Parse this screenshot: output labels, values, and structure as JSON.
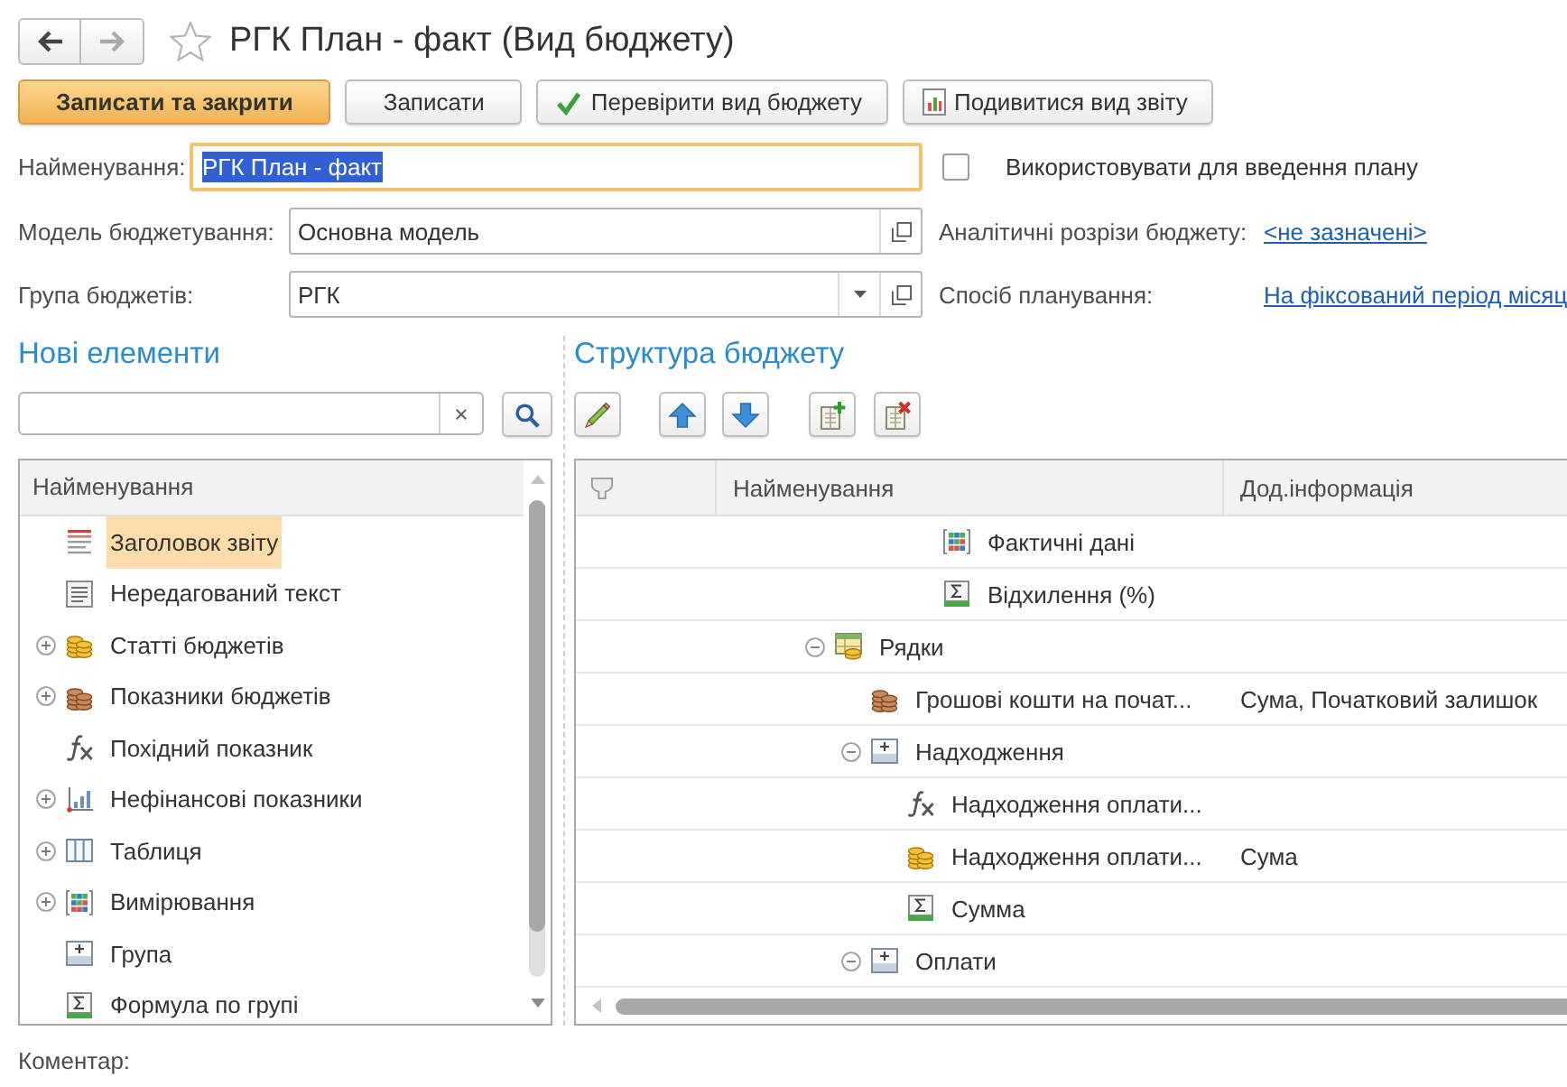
{
  "window": {
    "title": "РГК План - факт (Вид бюджету)",
    "favorite": false
  },
  "navigation": {
    "back": {
      "disabled": false
    },
    "forward": {
      "disabled": true
    }
  },
  "toolbar": [
    {
      "kind": "save_close",
      "label": "Записати та закрити"
    },
    {
      "kind": "save",
      "label": "Записати"
    },
    {
      "kind": "check",
      "label": "Перевірити вид бюджету"
    },
    {
      "kind": "view_report",
      "label": "Подивитися вид звіту"
    }
  ],
  "form": {
    "name": {
      "label": "Найменування:",
      "value": "РГК План - факт",
      "focused": true
    },
    "use_for_plan": {
      "label": "Використовувати для введення плану",
      "checked": false
    },
    "model": {
      "label": "Модель бюджетування:",
      "value": "Основна модель"
    },
    "analytics": {
      "label": "Аналітичні розрізи бюджету:",
      "link": "<не зазначені>"
    },
    "group": {
      "label": "Група бюджетів:",
      "value": "РГК"
    },
    "planning": {
      "label": "Спосіб планування:",
      "link": "На фіксований період місяц"
    }
  },
  "new_elements": {
    "title": "Нові елементи",
    "column": "Найменування",
    "items": [
      {
        "kind": "report_header",
        "label": "Заголовок звіту",
        "selected": true
      },
      {
        "kind": "text",
        "label": "Нередагований текст",
        "selected": false
      },
      {
        "kind": "budget_item",
        "label": "Статті бюджетів",
        "selected": false,
        "expanded": false
      },
      {
        "kind": "indicator",
        "label": "Показники бюджетів",
        "selected": false,
        "expanded": false
      },
      {
        "kind": "derived",
        "label": "Похідний показник",
        "selected": false
      },
      {
        "kind": "nonfinancial",
        "label": "Нефінансові показники",
        "selected": false,
        "expanded": false
      },
      {
        "kind": "table",
        "label": "Таблиця",
        "selected": false,
        "expanded": false
      },
      {
        "kind": "dimension",
        "label": "Вимірювання",
        "selected": false,
        "expanded": false
      },
      {
        "kind": "group",
        "label": "Група",
        "selected": false
      },
      {
        "kind": "group_formula",
        "label": "Формула по групі",
        "selected": false
      }
    ]
  },
  "structure": {
    "title": "Структура бюджету",
    "columns": [
      "Найменування",
      "Дод.інформація"
    ],
    "rows": [
      {
        "children": [
          {
            "children": [
              {
                "children": [
                  {
                    "kind": "dimension",
                    "label": "Фактичні дані"
                  },
                  {
                    "kind": "group_formula",
                    "label": "Відхилення (%)"
                  }
                ]
              }
            ]
          }
        ]
      },
      {
        "kind": "rows",
        "label": "Рядки",
        "expanded": true,
        "children": [
          {
            "kind": "indicator",
            "label": "Грошові кошти на почат...",
            "info": "Сума, Початковий залишок"
          },
          {
            "kind": "group",
            "label": "Надходження",
            "expanded": true,
            "children": [
              {
                "kind": "derived",
                "label": "Надходження оплати..."
              },
              {
                "kind": "budget_item",
                "label": "Надходження оплати...",
                "info": "Сума"
              },
              {
                "kind": "group_formula",
                "label": "Сумма"
              }
            ]
          },
          {
            "kind": "group",
            "label": "Оплати",
            "expanded": true
          }
        ]
      }
    ]
  },
  "comment": {
    "label": "Коментар:"
  }
}
